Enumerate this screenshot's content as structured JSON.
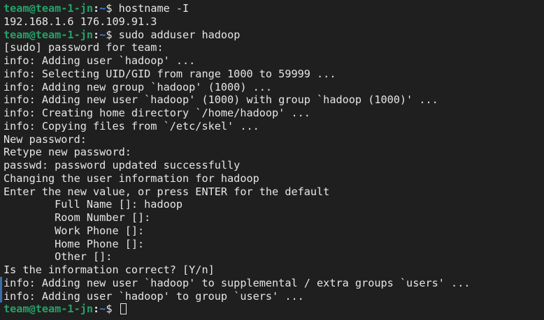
{
  "colors": {
    "background": "#1f1f1f",
    "foreground": "#e6e6e6",
    "prompt_user": "#26a269",
    "prompt_path": "#3b82d8",
    "marker": "#3b6ea8"
  },
  "prompt": {
    "user_host": "team@team-1-jn",
    "separator": ":",
    "path": "~",
    "sign": "$ "
  },
  "lines": [
    {
      "type": "cmd",
      "text": "hostname -I"
    },
    {
      "type": "out",
      "text": "192.168.1.6 176.109.91.3"
    },
    {
      "type": "cmd",
      "text": "sudo adduser hadoop"
    },
    {
      "type": "out",
      "text": "[sudo] password for team:"
    },
    {
      "type": "out",
      "text": "info: Adding user `hadoop' ..."
    },
    {
      "type": "out",
      "text": "info: Selecting UID/GID from range 1000 to 59999 ..."
    },
    {
      "type": "out",
      "text": "info: Adding new group `hadoop' (1000) ..."
    },
    {
      "type": "out",
      "text": "info: Adding new user `hadoop' (1000) with group `hadoop (1000)' ..."
    },
    {
      "type": "out",
      "text": "info: Creating home directory `/home/hadoop' ..."
    },
    {
      "type": "out",
      "text": "info: Copying files from `/etc/skel' ..."
    },
    {
      "type": "out",
      "text": "New password:"
    },
    {
      "type": "out",
      "text": "Retype new password:"
    },
    {
      "type": "out",
      "text": "passwd: password updated successfully"
    },
    {
      "type": "out",
      "text": "Changing the user information for hadoop"
    },
    {
      "type": "out",
      "text": "Enter the new value, or press ENTER for the default"
    },
    {
      "type": "out",
      "text": "        Full Name []: hadoop"
    },
    {
      "type": "out",
      "text": "        Room Number []:"
    },
    {
      "type": "out",
      "text": "        Work Phone []:"
    },
    {
      "type": "out",
      "text": "        Home Phone []:"
    },
    {
      "type": "out",
      "text": "        Other []:"
    },
    {
      "type": "out",
      "text": "Is the information correct? [Y/n]"
    },
    {
      "type": "out",
      "text": "info: Adding new user `hadoop' to supplemental / extra groups `users' ..."
    },
    {
      "type": "out",
      "text": "info: Adding user `hadoop' to group `users' ..."
    },
    {
      "type": "cmd",
      "text": ""
    }
  ]
}
